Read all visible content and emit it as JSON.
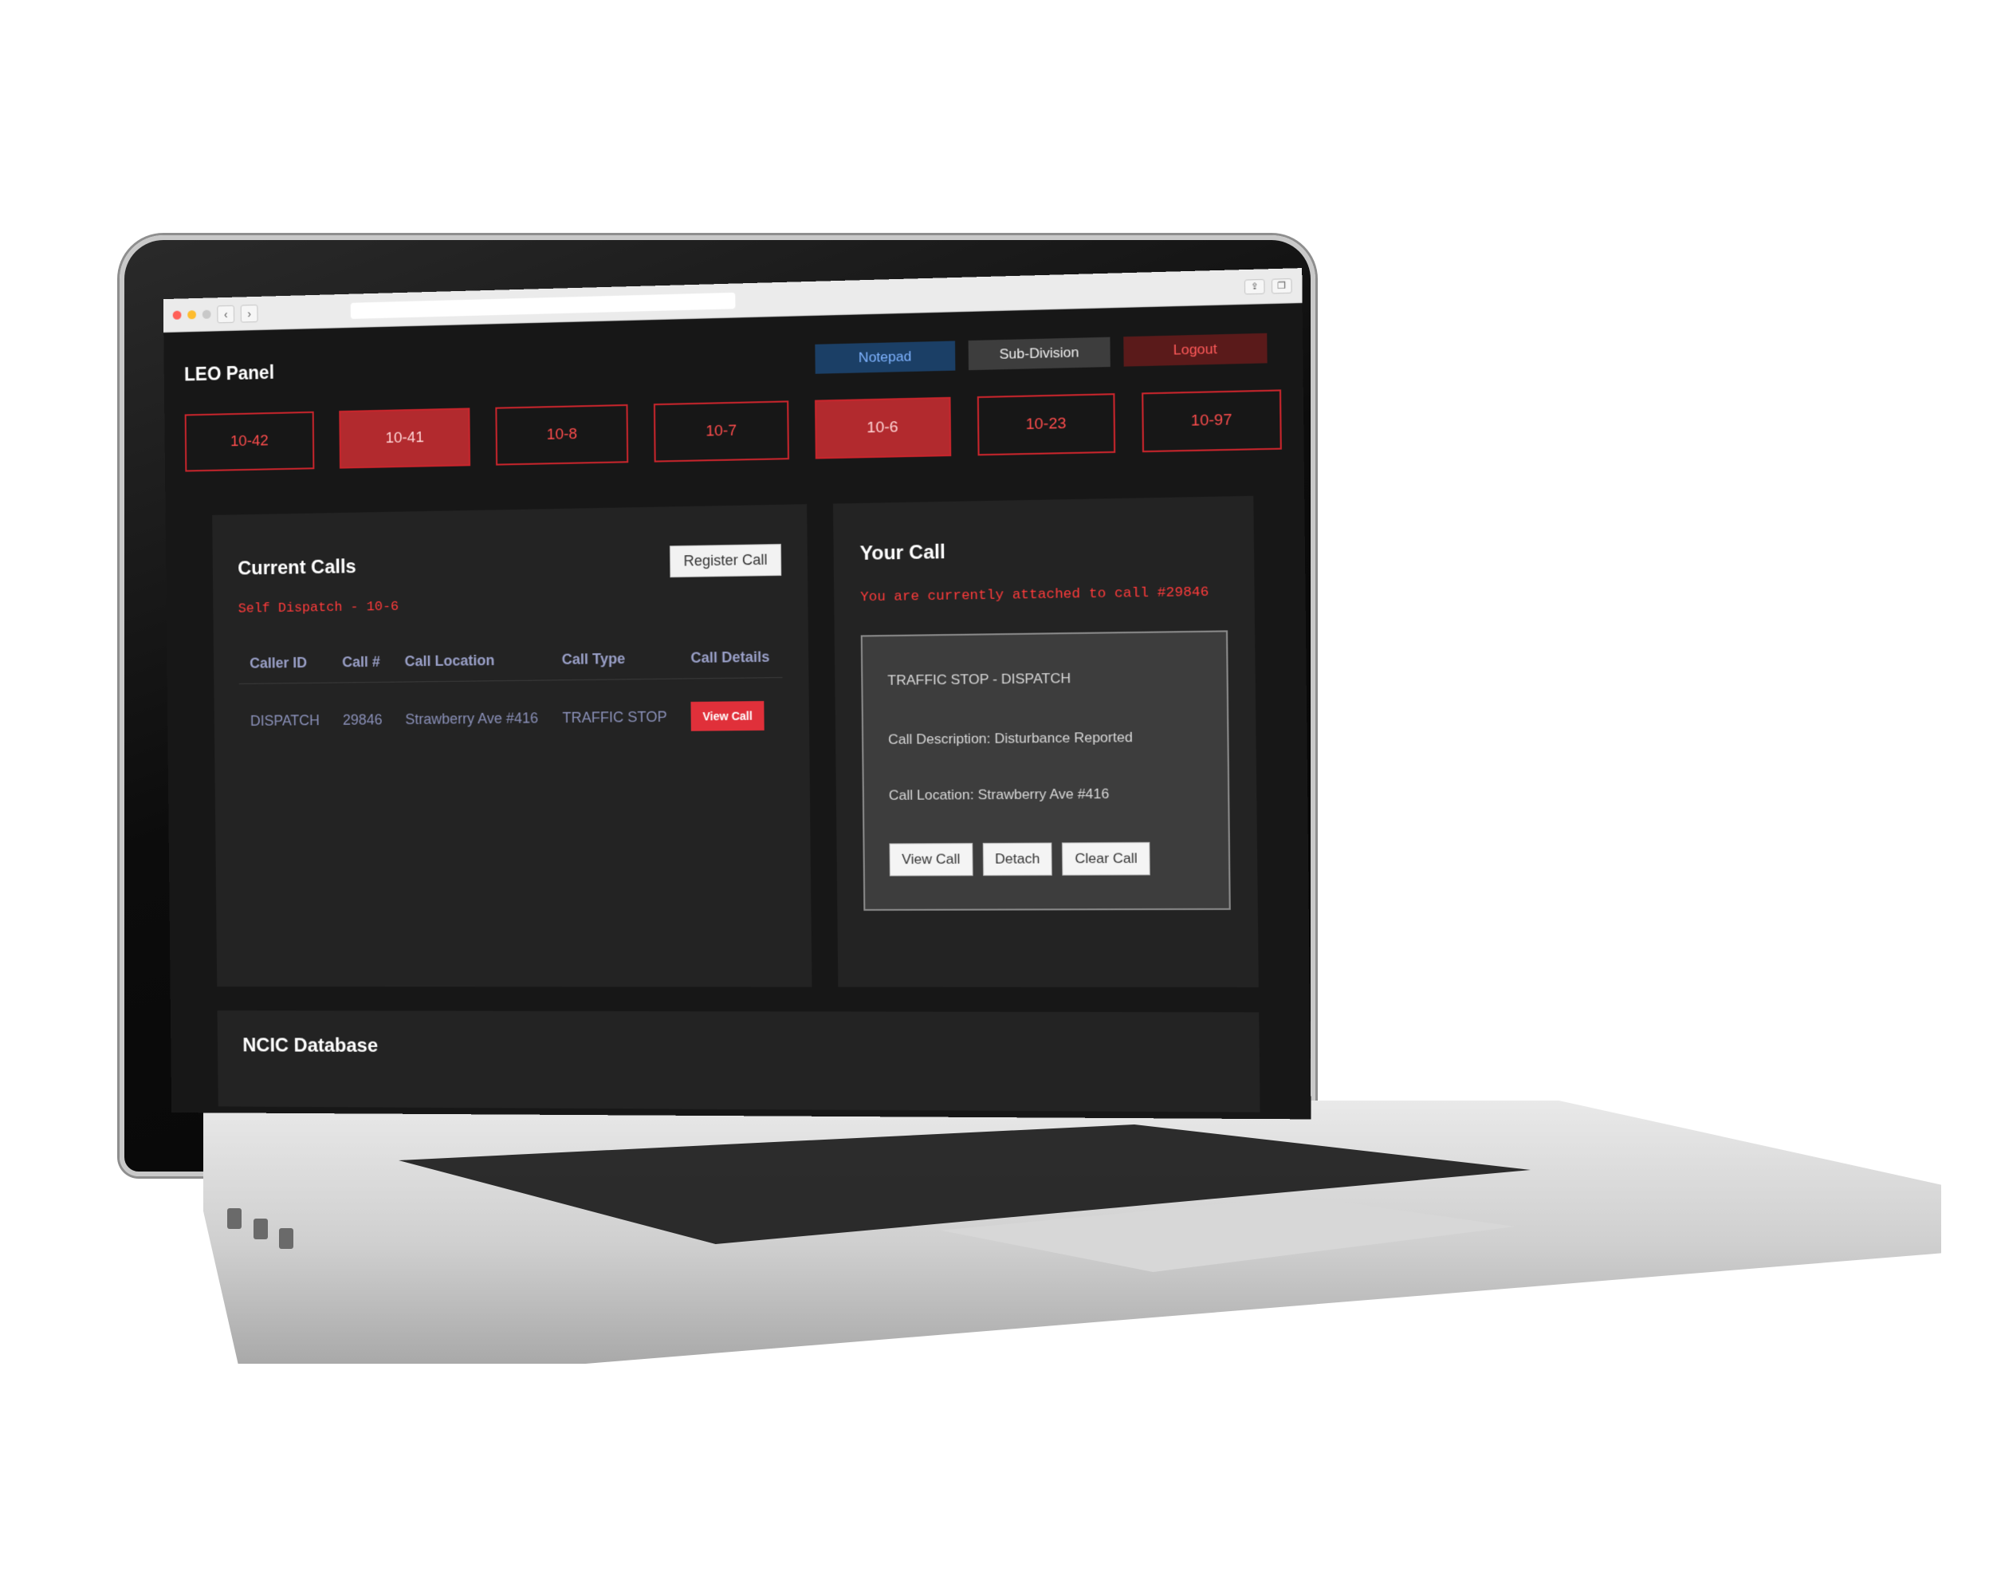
{
  "brand": {
    "title": "LEO Panel"
  },
  "top_buttons": {
    "notepad": "Notepad",
    "subdivision": "Sub-Division",
    "logout": "Logout"
  },
  "status_codes": [
    "10-42",
    "10-41",
    "10-8",
    "10-7",
    "10-6",
    "10-23",
    "10-97"
  ],
  "status_active": [
    "10-41",
    "10-6"
  ],
  "current_calls": {
    "title": "Current Calls",
    "register_label": "Register Call",
    "self_dispatch": "Self Dispatch - 10-6",
    "columns": [
      "Caller ID",
      "Call #",
      "Call Location",
      "Call Type",
      "Call Details"
    ],
    "rows": [
      {
        "caller_id": "DISPATCH",
        "call_no": "29846",
        "location": "Strawberry Ave #416",
        "type": "TRAFFIC STOP",
        "action": "View Call"
      }
    ]
  },
  "your_call": {
    "title": "Your Call",
    "attached_note": "You are currently attached to call #29846",
    "heading": "TRAFFIC STOP - DISPATCH",
    "description": "Call Description: Disturbance Reported",
    "location": "Call Location: Strawberry Ave #416",
    "buttons": {
      "view": "View Call",
      "detach": "Detach",
      "clear": "Clear Call"
    }
  },
  "ncic": {
    "title": "NCIC Database"
  },
  "colors": {
    "accent_red": "#c9252c",
    "active_red": "#b22a2e",
    "notepad_blue": "#1b3f66",
    "background": "#171717"
  }
}
